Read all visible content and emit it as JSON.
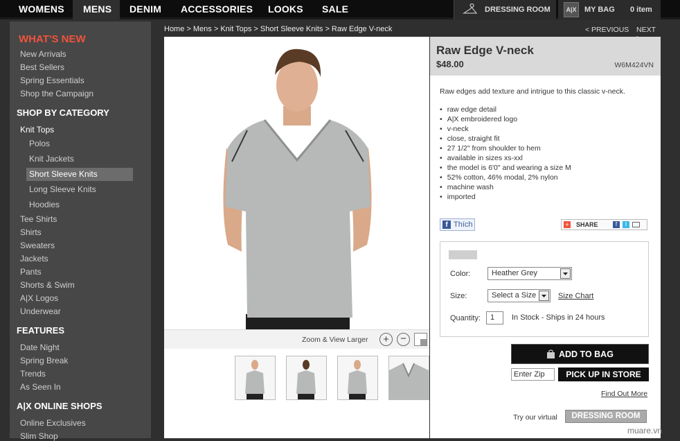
{
  "nav": {
    "items": [
      "WOMENS",
      "MENS",
      "DENIM",
      "ACCESSORIES",
      "LOOKS",
      "SALE"
    ],
    "dressing_room": "DRESSING ROOM",
    "my_bag": "MY BAG",
    "bag_count": "0 item"
  },
  "sidebar": {
    "whats_new": {
      "heading": "WHAT'S NEW",
      "items": [
        "New Arrivals",
        "Best Sellers",
        "Spring Essentials",
        "Shop the Campaign"
      ]
    },
    "category": {
      "heading": "SHOP BY CATEGORY",
      "parent": "Knit Tops",
      "sub": [
        "Polos",
        "Knit Jackets",
        "Short Sleeve Knits",
        "Long Sleeve Knits",
        "Hoodies"
      ],
      "items": [
        "Tee Shirts",
        "Shirts",
        "Sweaters",
        "Jackets",
        "Pants",
        "Shorts & Swim",
        "A|X Logos",
        "Underwear"
      ]
    },
    "features": {
      "heading": "FEATURES",
      "items": [
        "Date Night",
        "Spring Break",
        "Trends",
        "As Seen In"
      ]
    },
    "online": {
      "heading": "A|X ONLINE SHOPS",
      "items": [
        "Online Exclusives",
        "Slim Shop"
      ]
    }
  },
  "breadcrumb": "Home > Mens > Knit Tops > Short Sleeve Knits > Raw Edge V-neck",
  "pager": {
    "prev": "< PREVIOUS",
    "next": "NEXT >"
  },
  "zoom_label": "Zoom & View Larger",
  "product": {
    "title": "Raw Edge V-neck",
    "price": "$48.00",
    "sku": "W6M424VN",
    "description": "Raw edges add texture and intrigue to this classic v-neck.",
    "bullets": [
      "raw edge detail",
      "A|X embroidered logo",
      "v-neck",
      "close, straight fit",
      "27 1/2\" from shoulder to hem",
      "available in sizes xs-xxl",
      "the model is 6'0\" and wearing a size M",
      "52% cotton, 46% modal, 2% nylon",
      "machine wash",
      "imported"
    ]
  },
  "social": {
    "like": "Thích",
    "share": "SHARE"
  },
  "options": {
    "color_label": "Color:",
    "color_value": "Heather Grey",
    "size_label": "Size:",
    "size_value": "Select a Size",
    "size_chart": "Size Chart",
    "qty_label": "Quantity:",
    "qty_value": "1",
    "stock": "In Stock - Ships in 24 hours"
  },
  "actions": {
    "add_to_bag": "ADD TO BAG",
    "zip_placeholder": "Enter Zip",
    "pickup": "PICK UP IN STORE",
    "find_out": "Find Out More",
    "try_virtual": "Try our virtual",
    "dressing_room": "DRESSING ROOM"
  },
  "watermark": "muare.vn",
  "colors": {
    "accent_red": "#f0533d",
    "swatch": "#cfcfcf",
    "shirt": "#b7b9b8"
  }
}
